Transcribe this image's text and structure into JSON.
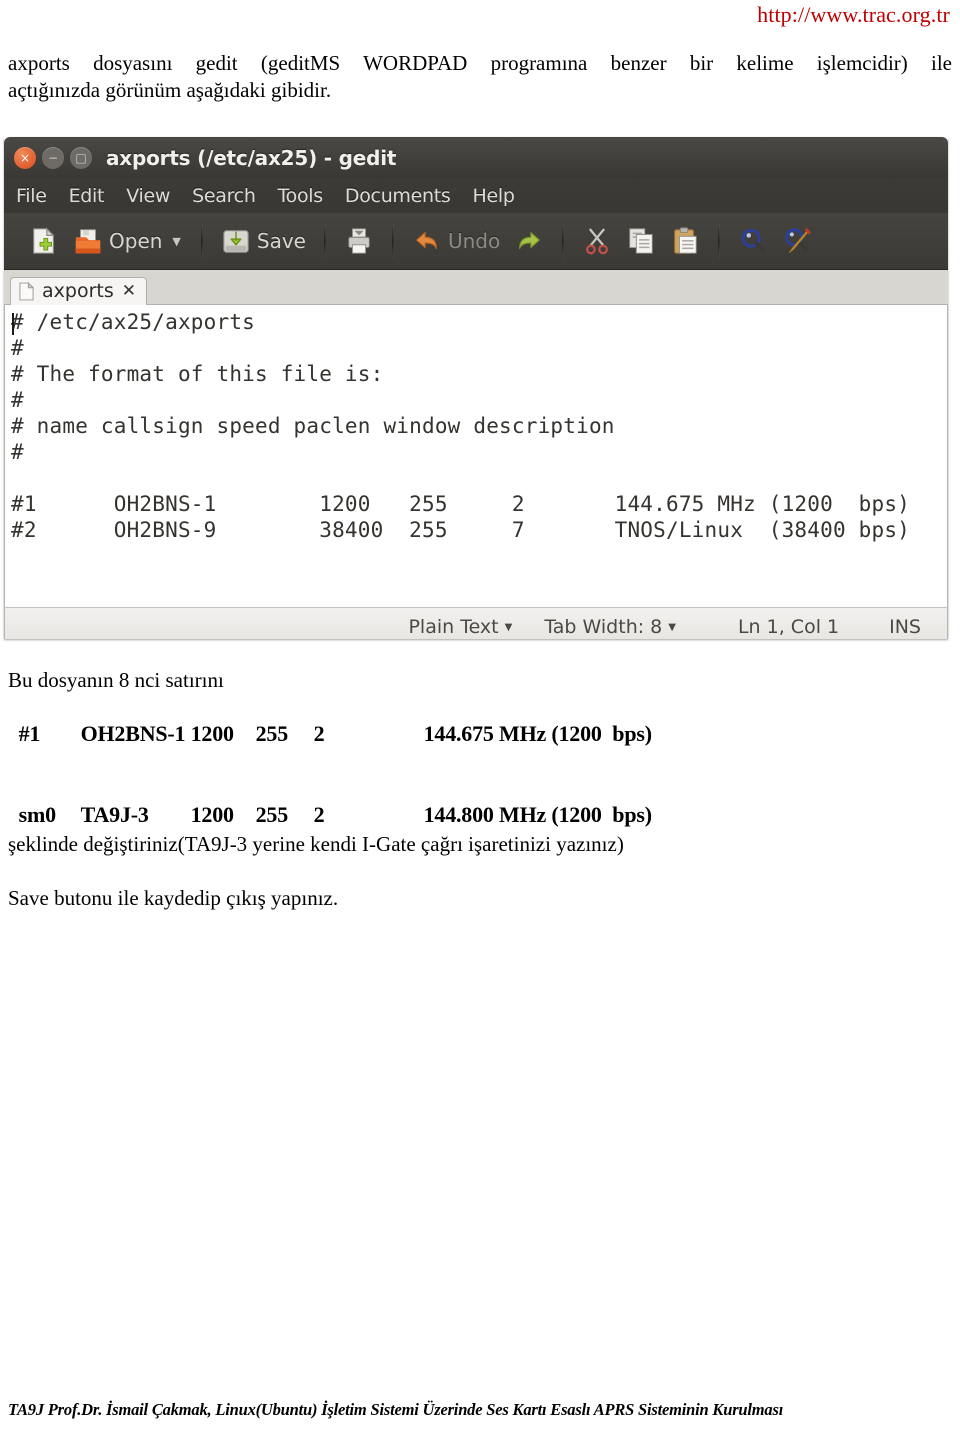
{
  "page": {
    "url": "http://www.trac.org.tr",
    "intro_line1": "axports dosyasını gedit (geditMS WORDPAD programına benzer bir kelime işlemcidir) ile",
    "intro_line2": "açtığınızda görünüm aşağıdaki gibidir.",
    "footer": "TA9J Prof.Dr. İsmail Çakmak,  Linux(Ubuntu) İşletim Sistemi Üzerinde Ses Kartı Esaslı APRS Sisteminin Kurulması"
  },
  "gedit": {
    "title": "axports (/etc/ax25) - gedit",
    "window_buttons": {
      "close": "×",
      "minimize": "−",
      "maximize": "□"
    },
    "menu": [
      "File",
      "Edit",
      "View",
      "Search",
      "Tools",
      "Documents",
      "Help"
    ],
    "toolbar": {
      "new_icon": "new-document-icon",
      "open_label": "Open",
      "open_icon": "open-folder-icon",
      "open_caret": "▼",
      "save_label": "Save",
      "save_icon": "save-disk-icon",
      "print_icon": "printer-icon",
      "undo_label": "Undo",
      "undo_icon": "undo-arrow-icon",
      "redo_icon": "redo-arrow-icon",
      "cut_icon": "scissors-icon",
      "copy_icon": "copy-icon",
      "paste_icon": "clipboard-paste-icon",
      "find_icon": "magnifier-icon",
      "replace_icon": "find-replace-icon"
    },
    "tab": {
      "label": "axports",
      "close": "✕",
      "icon": "document-icon"
    },
    "document": {
      "lines": [
        "# /etc/ax25/axports",
        "#",
        "# The format of this file is:",
        "#",
        "# name callsign speed paclen window description",
        "#",
        "",
        "#1      OH2BNS-1        1200   255     2       144.675 MHz (1200  bps)",
        "#2      OH2BNS-9        38400  255     7       TNOS/Linux  (38400 bps)"
      ]
    },
    "statusbar": {
      "language": "Plain Text",
      "language_caret": "▼",
      "tab_width": "Tab Width: 8",
      "tab_width_caret": "▼",
      "position": "Ln 1, Col 1",
      "insert_mode": "INS"
    }
  },
  "instructions": {
    "line_prompt": "Bu dosyanın 8 nci satırını",
    "original_row": {
      "name": "#1",
      "callsign": "OH2BNS-1",
      "speed": "1200",
      "paclen": "255",
      "window": "2",
      "description": "144.675 MHz (1200  bps)"
    },
    "new_row": {
      "name": "sm0",
      "callsign": "TA9J-3",
      "speed": "1200",
      "paclen": "255",
      "window": "2",
      "description": "144.800 MHz (1200  bps)"
    },
    "change_note": "şeklinde değiştiriniz(TA9J-3 yerine kendi I-Gate çağrı işaretinizi yazınız)",
    "save_note": "Save butonu ile kaydedip çıkış yapınız."
  },
  "colors": {
    "url_red": "#c00000",
    "titlebar_dark": "#413f3b",
    "close_orange": "#d94b1a",
    "editor_bg": "#ffffff"
  }
}
